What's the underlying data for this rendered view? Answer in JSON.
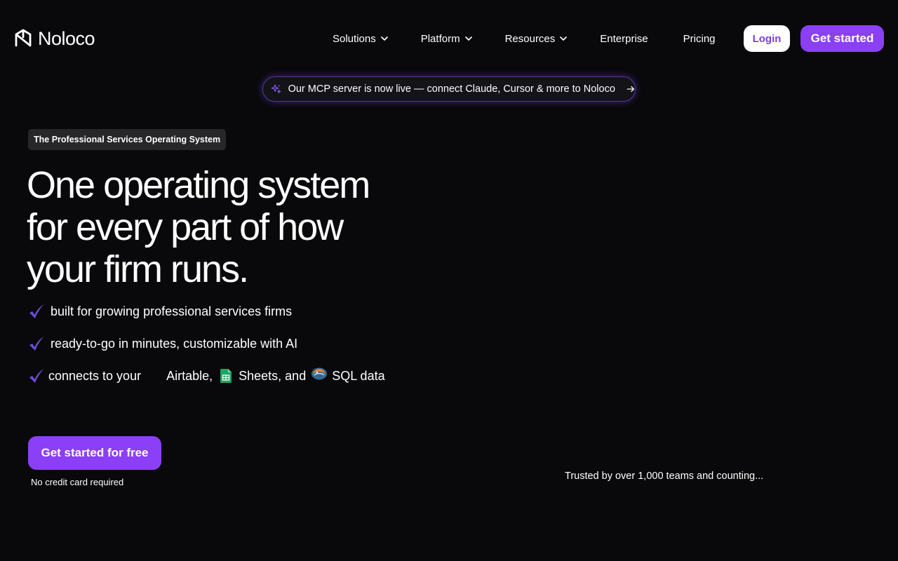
{
  "colors": {
    "background": "#09090b",
    "accent": "#8b3ff6",
    "accent_text": "#7c3aed",
    "check": "#6d4cd8",
    "sheets_green": "#1ea362"
  },
  "header": {
    "logo_text": "Noloco",
    "nav": [
      {
        "label": "Solutions",
        "has_dropdown": true
      },
      {
        "label": "Platform",
        "has_dropdown": true
      },
      {
        "label": "Resources",
        "has_dropdown": true
      },
      {
        "label": "Enterprise",
        "has_dropdown": false
      },
      {
        "label": "Pricing",
        "has_dropdown": false
      }
    ],
    "login_label": "Login",
    "get_started_label": "Get started"
  },
  "announcement": {
    "icon": "sparkle-icon",
    "text": "Our MCP server is now live — connect Claude, Cursor & more to Noloco",
    "arrow_icon": "arrow-right-icon"
  },
  "hero": {
    "eyebrow": "The Professional Services Operating System",
    "headline_lines": [
      "One operating system",
      "for every part of how",
      "your firm runs."
    ],
    "features": [
      "built for growing professional services firms",
      "ready-to-go in minutes, customizable with AI"
    ],
    "connects": {
      "prefix": "connects to your",
      "sources": [
        {
          "label": "Airtable,",
          "icon": "airtable-icon"
        },
        {
          "label": "Sheets, and",
          "icon": "google-sheets-icon"
        },
        {
          "label": "SQL data",
          "icon": "postgresql-icon"
        }
      ]
    },
    "cta_label": "Get started for free",
    "cta_note": "No credit card required"
  },
  "trusted_text": "Trusted by over 1,000 teams and counting..."
}
